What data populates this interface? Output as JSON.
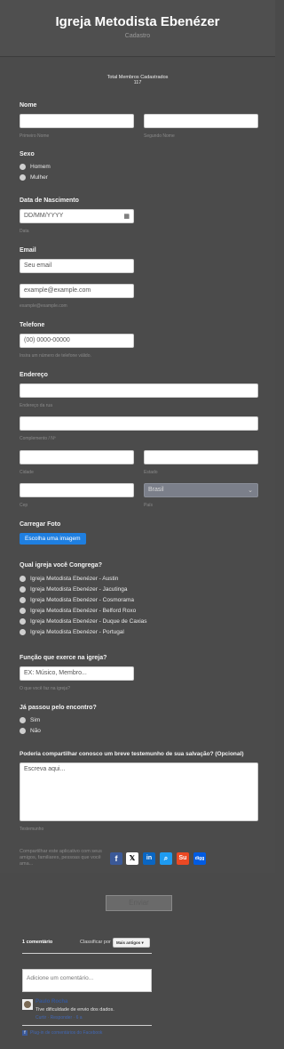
{
  "header": {
    "title": "Igreja Metodista Ebenézer",
    "subtitle": "Cadastro"
  },
  "counter": {
    "label": "Total Membros Cadastrados",
    "value": "117"
  },
  "nome": {
    "label": "Nome",
    "first_hint": "Primeiro Nome",
    "last_hint": "Segundo Nome"
  },
  "sexo": {
    "label": "Sexo",
    "options": [
      "Homem",
      "Mulher"
    ]
  },
  "nascimento": {
    "label": "Data de Nascimento",
    "placeholder": "DD/MM/YYYY",
    "hint": "Data"
  },
  "email": {
    "label": "Email",
    "value": "Seu email",
    "confirm_value": "example@example.com",
    "hint": "example@example.com"
  },
  "telefone": {
    "label": "Telefone",
    "value": "(00) 0000-00000",
    "hint": "Insira um número de telefone válido."
  },
  "endereco": {
    "label": "Endereço",
    "hint_rua": "Endereço da rua",
    "hint_complemento": "Complemento / Nº",
    "hint_cidade": "Cidade",
    "hint_estado": "Estado",
    "hint_cep": "Cep",
    "hint_pais": "País",
    "pais_value": "Brasil"
  },
  "foto": {
    "label": "Carregar Foto",
    "button": "Escolha uma imagem"
  },
  "igreja": {
    "label": "Qual igreja você Congrega?",
    "options": [
      "Igreja Metodista Ebenézer - Austin",
      "Igreja Metodista Ebenézer - Jacutinga",
      "Igreja Metodista Ebenézer - Cosmorama",
      "Igreja Metodista Ebenézer - Belford Roxo",
      "Igreja Metodista Ebenézer - Duque de Caxias",
      "Igreja Metodista Ebenézer - Portugal"
    ]
  },
  "funcao": {
    "label": "Função que exerce na igreja?",
    "placeholder": "EX: Músico, Membro...",
    "hint": "O que você faz na igreja?"
  },
  "encontro": {
    "label": "Já passou pelo encontro?",
    "options": [
      "Sim",
      "Não"
    ]
  },
  "testemunho": {
    "label": "Poderia compartilhar conosco um breve testemunho de sua salvação? (Opcional)",
    "placeholder": "Escreva aqui...",
    "hint": "Testemunho"
  },
  "share": {
    "text": "Compartilhar este aplicativo com seus amigos, familiares, pessoas que você ama...",
    "icons": [
      "f",
      "𝕏",
      "in",
      "⌕",
      "Su",
      "digg"
    ]
  },
  "submit": {
    "label": "Enviar"
  },
  "comments": {
    "count": "1 comentário",
    "sort_label": "Classificar por",
    "sort_value": "Mais antigos",
    "placeholder": "Adicione um comentário...",
    "author": "Paulo Rocha",
    "text": "Tive dificuldade de envio dos dados.",
    "actions": "Curtir · Responder · 6 a",
    "plugin": "Plug-in de comentários do Facebook"
  },
  "colors": {
    "accent": "#1f7fe0",
    "page_bg": "#4b4b4b",
    "header_bg": "#4f4f4f"
  }
}
